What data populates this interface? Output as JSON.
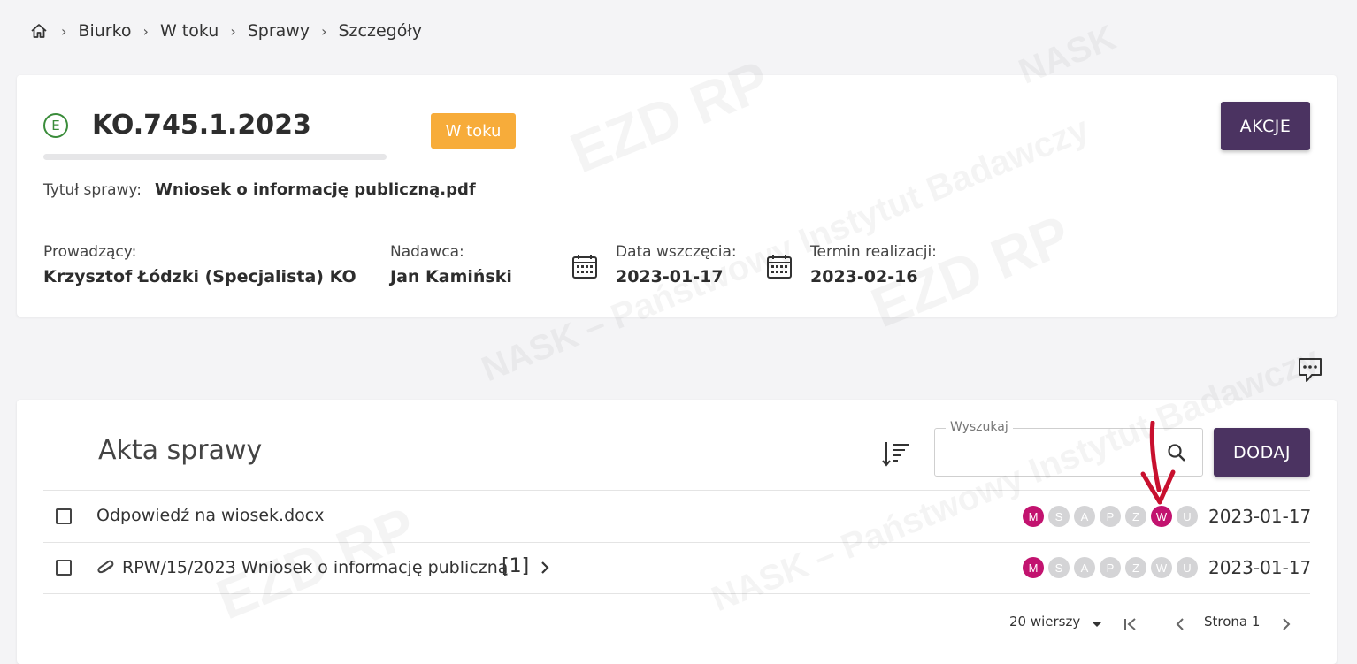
{
  "breadcrumb": {
    "home_icon": "home-icon",
    "items": [
      "Biurko",
      "W toku",
      "Sprawy",
      "Szczegóły"
    ],
    "separator": "›"
  },
  "case": {
    "type_letter": "E",
    "number": "KO.745.1.2023",
    "status": "W toku",
    "status_color": "#f7ac3a",
    "actions_label": "AKCJE",
    "title_label": "Tytuł sprawy:",
    "title_value": "Wniosek o informację publiczną.pdf",
    "lead_label": "Prowadzący:",
    "lead_value": "Krzysztof Łódzki (Specjalista) KO",
    "sender_label": "Nadawca:",
    "sender_value": "Jan Kamiński",
    "start_label": "Data wszczęcia:",
    "start_value": "2023-01-17",
    "deadline_label": "Termin realizacji:",
    "deadline_value": "2023-02-16"
  },
  "files": {
    "title": "Akta sprawy",
    "search_label": "Wyszukaj",
    "search_value": "",
    "add_label": "DODAJ",
    "rows": [
      {
        "name": "Odpowiedź na wiosek.docx",
        "date": "2023-01-17",
        "flags": [
          {
            "letter": "M",
            "active": true
          },
          {
            "letter": "S",
            "active": false
          },
          {
            "letter": "A",
            "active": false
          },
          {
            "letter": "P",
            "active": false
          },
          {
            "letter": "Z",
            "active": false
          },
          {
            "letter": "W",
            "active": true
          },
          {
            "letter": "U",
            "active": false
          }
        ]
      },
      {
        "name": "RPW/15/2023 Wniosek o informację publiczną",
        "count": "[1]",
        "date": "2023-01-17",
        "flags": [
          {
            "letter": "M",
            "active": true
          },
          {
            "letter": "S",
            "active": false
          },
          {
            "letter": "A",
            "active": false
          },
          {
            "letter": "P",
            "active": false
          },
          {
            "letter": "Z",
            "active": false
          },
          {
            "letter": "W",
            "active": false
          },
          {
            "letter": "U",
            "active": false
          }
        ]
      }
    ],
    "pagination": {
      "rows_per_page": "20 wierszy",
      "page_label": "Strona 1"
    }
  },
  "colors": {
    "accent": "#4b3361",
    "flag_active": "#c2136f",
    "flag_inactive": "#d4d4d6",
    "annotation_arrow": "#c8102e"
  },
  "watermark": {
    "texts": [
      "EZD RP",
      "NASK",
      "NASK – Państwowy Instytut Badawczy"
    ]
  }
}
